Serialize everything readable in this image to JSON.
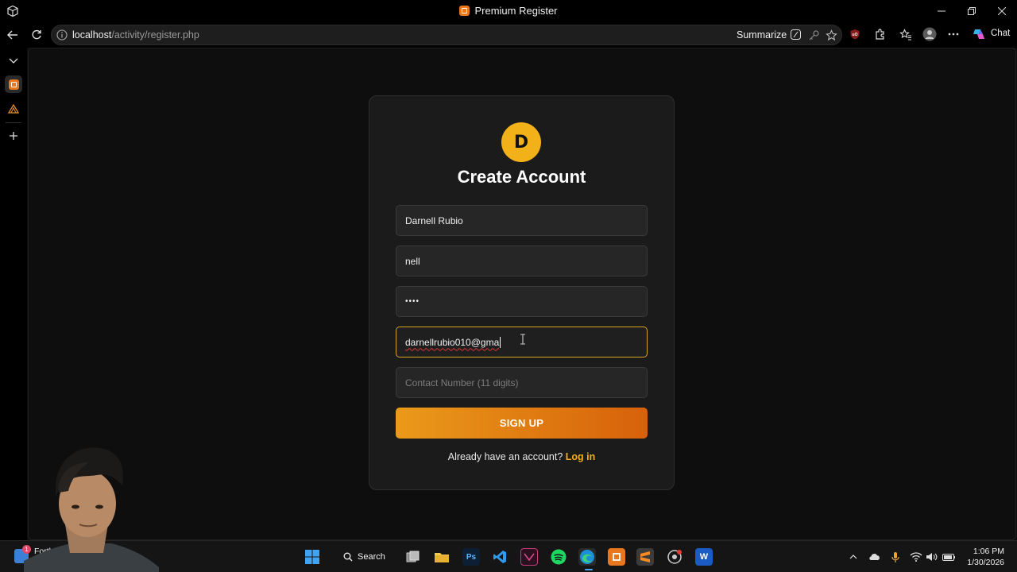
{
  "window": {
    "title": "Premium Register",
    "controls": [
      "minimize",
      "restore",
      "close"
    ]
  },
  "browser": {
    "url_host": "localhost",
    "url_path": "/activity/register.php",
    "summarize_label": "Summarize",
    "chat_label": "Chat"
  },
  "form": {
    "logo_letter": "D",
    "heading": "Create Account",
    "fields": [
      {
        "value": "Darnell Rubio",
        "placeholder": ""
      },
      {
        "value": "nell",
        "placeholder": ""
      },
      {
        "value": "••••",
        "placeholder": ""
      },
      {
        "value": "darnellrubio010@gma",
        "placeholder": ""
      },
      {
        "value": "",
        "placeholder": "Contact Number (11 digits)"
      }
    ],
    "submit_label": "SIGN UP",
    "login_prompt": "Already have an account?",
    "login_link": "Log in"
  },
  "taskbar": {
    "weather_label": "Forthc",
    "weather_badge": "1",
    "search_label": "Search",
    "time": "1:06 PM",
    "date": "1/30/2026"
  },
  "colors": {
    "accent": "#f2b118",
    "button_start": "#ea9a1a",
    "button_end": "#d7610a",
    "focus_border": "#d9a521"
  }
}
